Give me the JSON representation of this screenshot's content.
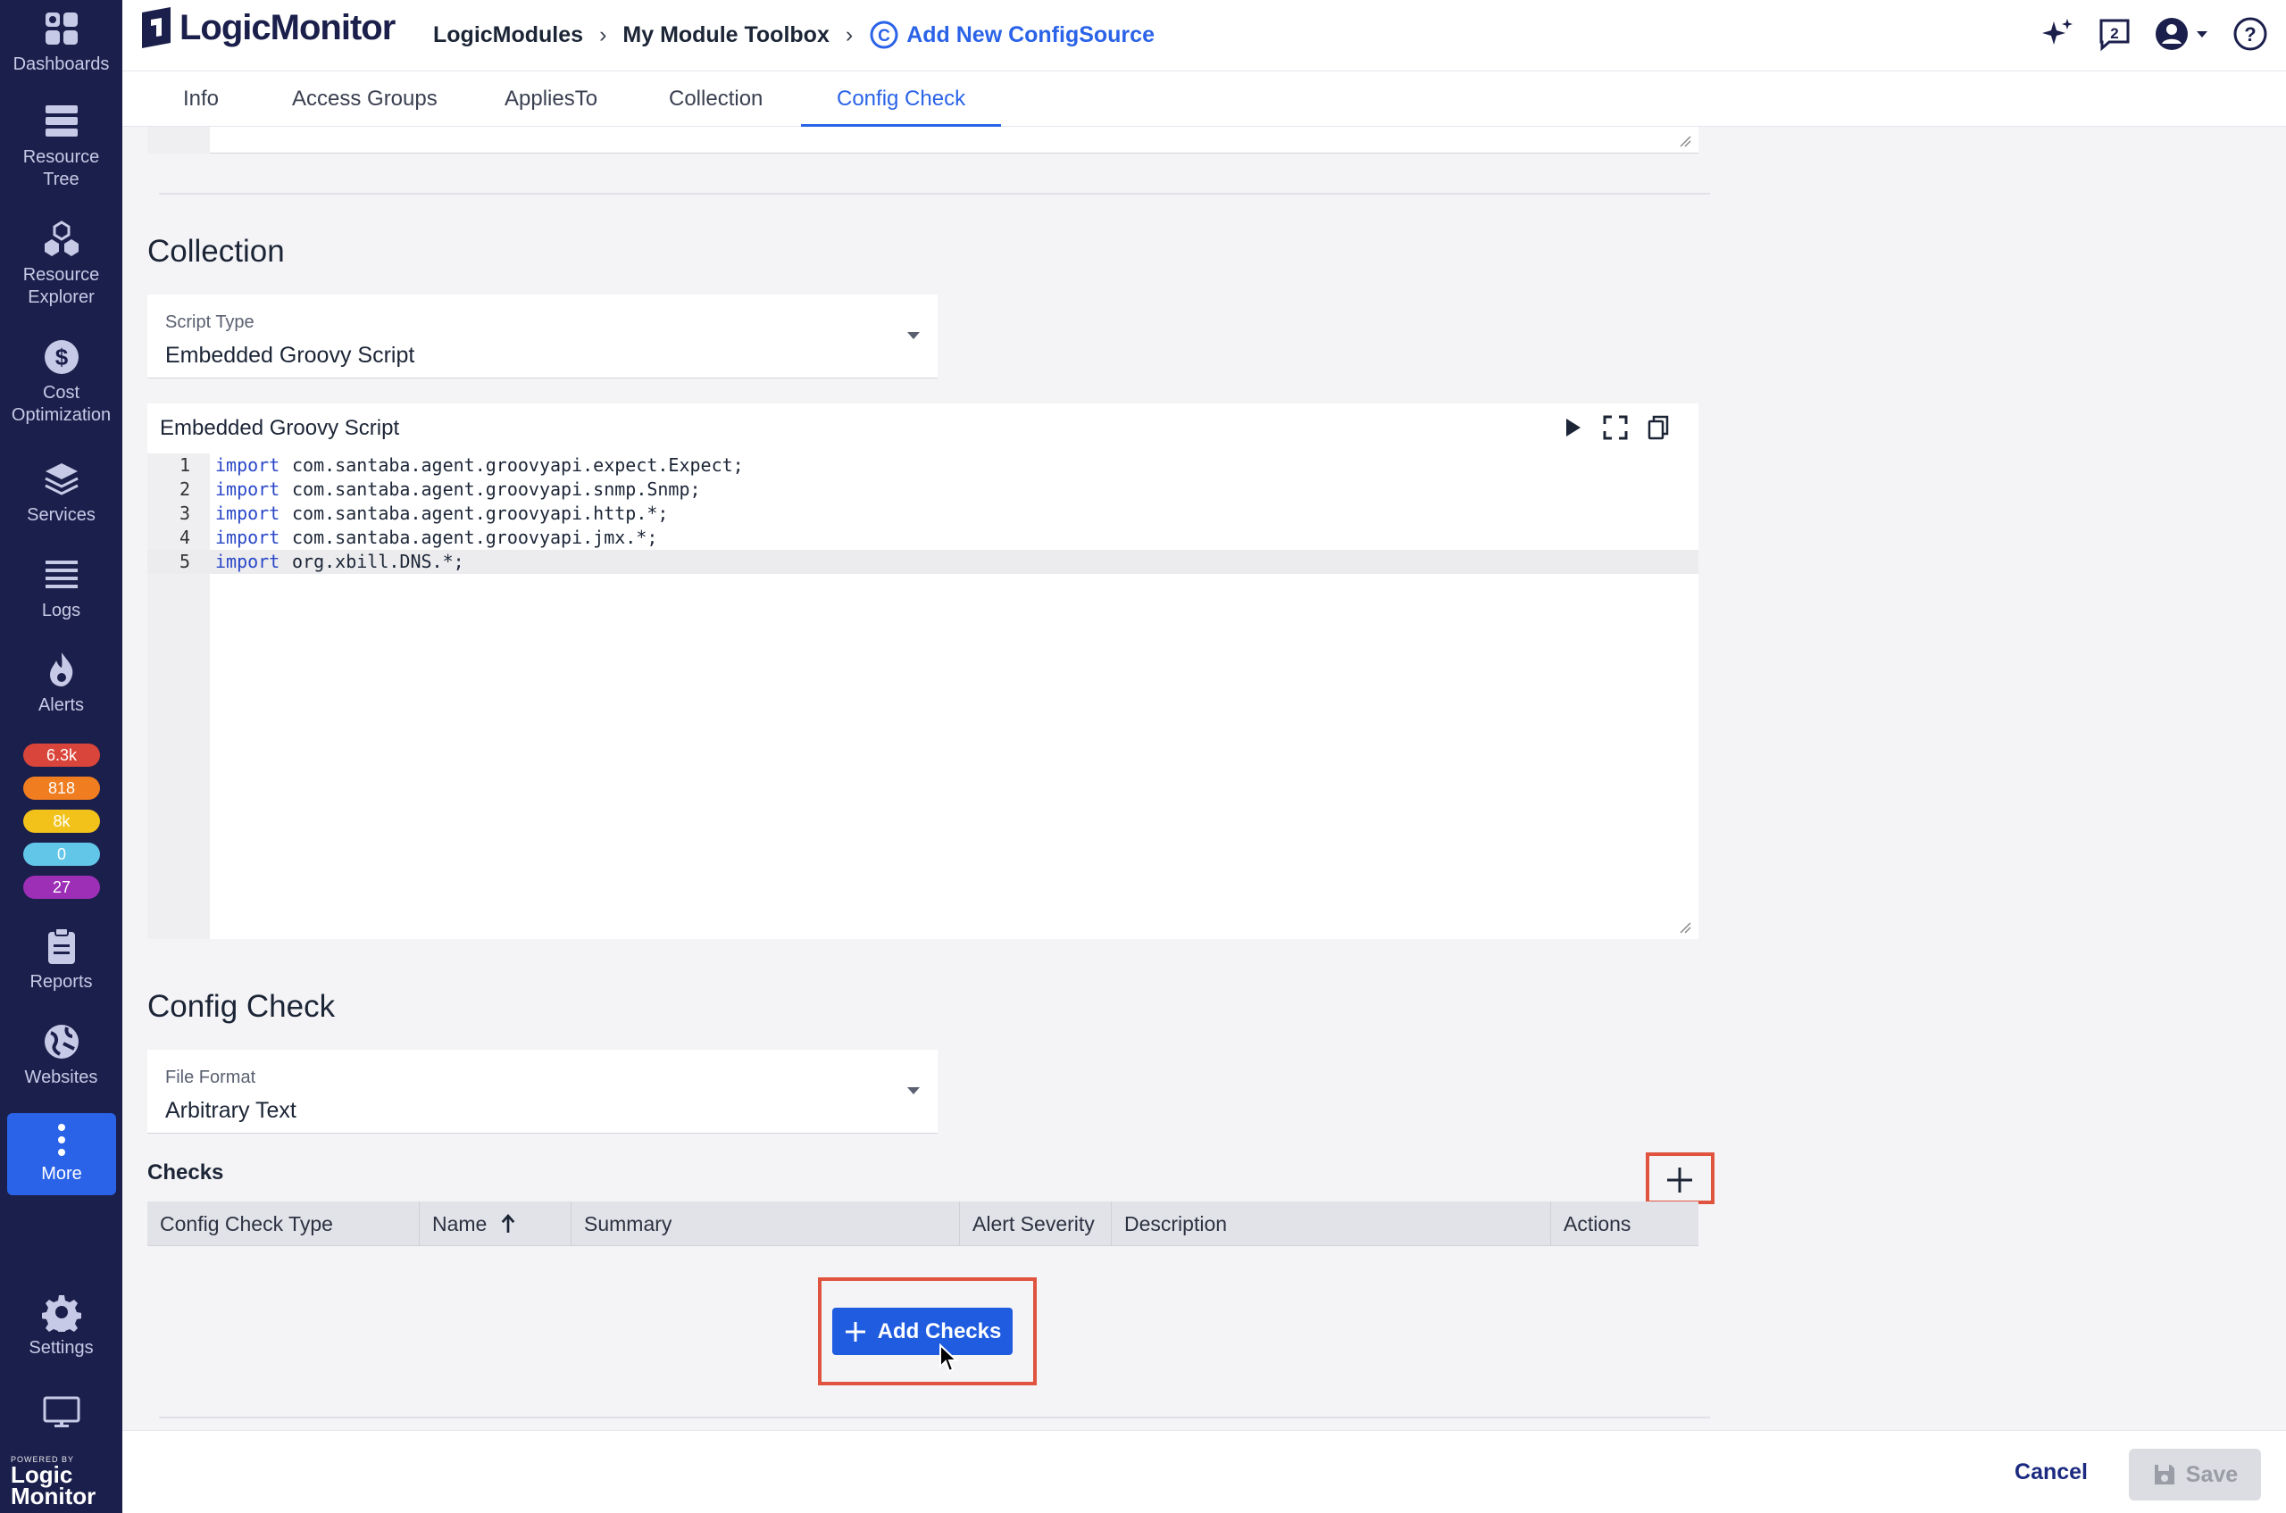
{
  "app": {
    "logo_text": "LogicMonitor"
  },
  "breadcrumb": {
    "items": [
      "LogicModules",
      "My Module Toolbox"
    ],
    "current": "Add New ConfigSource"
  },
  "header": {
    "notifications_count": "2"
  },
  "sidebar": {
    "items": [
      {
        "label": "Dashboards",
        "icon": "dashboards-icon"
      },
      {
        "label": "Resource Tree",
        "icon": "resource-tree-icon"
      },
      {
        "label": "Resource Explorer",
        "icon": "resource-explorer-icon"
      },
      {
        "label": "Cost Optimization",
        "icon": "cost-icon"
      },
      {
        "label": "Services",
        "icon": "layers-icon"
      },
      {
        "label": "Logs",
        "icon": "logs-icon"
      },
      {
        "label": "Alerts",
        "icon": "flame-icon"
      },
      {
        "label": "Reports",
        "icon": "clipboard-icon"
      },
      {
        "label": "Websites",
        "icon": "globe-icon"
      },
      {
        "label": "More",
        "icon": "more-vertical-icon"
      },
      {
        "label": "Settings",
        "icon": "gear-icon"
      }
    ],
    "alert_badges": [
      {
        "value": "6.3k",
        "color": "#d9453a"
      },
      {
        "value": "818",
        "color": "#f07d20"
      },
      {
        "value": "8k",
        "color": "#f2c21a"
      },
      {
        "value": "0",
        "color": "#62c6e8"
      },
      {
        "value": "27",
        "color": "#9c2fb5"
      }
    ],
    "powered_by_small": "POWERED BY",
    "powered_by_line1": "Logic",
    "powered_by_line2": "Monitor"
  },
  "tabs": [
    "Info",
    "Access Groups",
    "AppliesTo",
    "Collection",
    "Config Check"
  ],
  "active_tab": "Config Check",
  "collection": {
    "title": "Collection",
    "script_type_label": "Script Type",
    "script_type_value": "Embedded Groovy Script",
    "editor_title": "Embedded Groovy Script",
    "code_lines": [
      {
        "num": "1",
        "kw": "import",
        "rest": "com.santaba.agent.groovyapi.expect.Expect;"
      },
      {
        "num": "2",
        "kw": "import",
        "rest": "com.santaba.agent.groovyapi.snmp.Snmp;"
      },
      {
        "num": "3",
        "kw": "import",
        "rest": "com.santaba.agent.groovyapi.http.*;"
      },
      {
        "num": "4",
        "kw": "import",
        "rest": "com.santaba.agent.groovyapi.jmx.*;"
      },
      {
        "num": "5",
        "kw": "import",
        "rest": "org.xbill.DNS.*;"
      }
    ]
  },
  "config_check": {
    "title": "Config Check",
    "file_format_label": "File Format",
    "file_format_value": "Arbitrary Text",
    "checks_label": "Checks",
    "columns": [
      "Config Check Type",
      "Name",
      "Summary",
      "Alert Severity",
      "Description",
      "Actions"
    ],
    "add_checks_label": "Add Checks"
  },
  "footer": {
    "cancel_label": "Cancel",
    "save_label": "Save"
  },
  "colors": {
    "accent": "#2a63e8",
    "sidebar_bg": "#1b1f4b",
    "highlight_box": "#e0533f"
  }
}
